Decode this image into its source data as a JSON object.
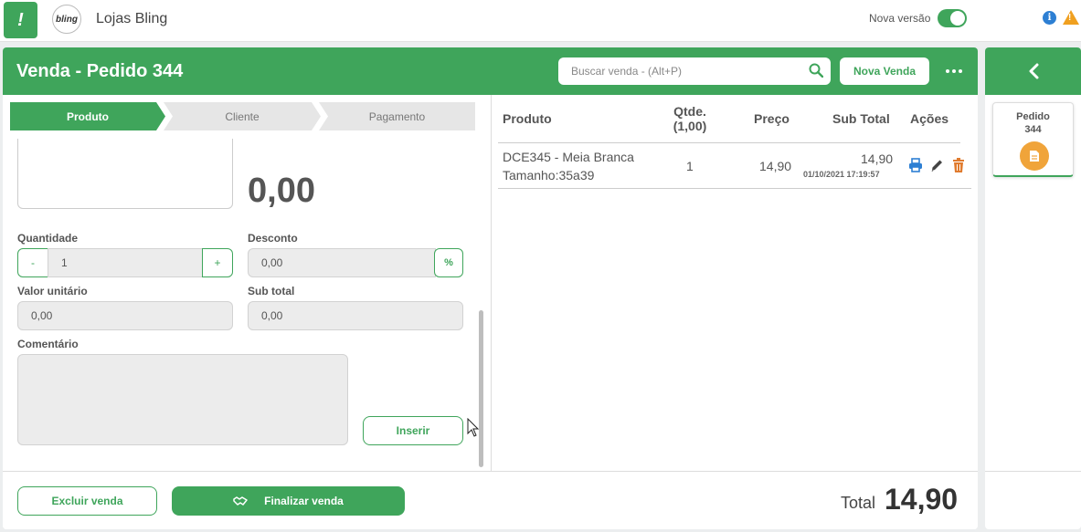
{
  "topbar": {
    "store_name": "Lojas Bling",
    "avatar_text": "bling",
    "new_version_label": "Nova versão",
    "new_version_enabled": true
  },
  "header": {
    "title": "Venda - Pedido 344",
    "search_placeholder": "Buscar venda - (Alt+P)",
    "new_sale_label": "Nova Venda"
  },
  "steps": [
    {
      "label": "Produto",
      "active": true
    },
    {
      "label": "Cliente",
      "active": false
    },
    {
      "label": "Pagamento",
      "active": false
    }
  ],
  "form": {
    "price_display": "0,00",
    "quantity_label": "Quantidade",
    "quantity_value": "1",
    "decrement_label": "-",
    "increment_label": "+",
    "discount_label": "Desconto",
    "discount_value": "0,00",
    "percent_label": "%",
    "unit_value_label": "Valor unitário",
    "unit_value": "0,00",
    "subtotal_label": "Sub total",
    "subtotal_value": "0,00",
    "comment_label": "Comentário",
    "insert_label": "Inserir"
  },
  "table": {
    "headers": {
      "product": "Produto",
      "qty_line1": "Qtde.",
      "qty_line2": "(1,00)",
      "price": "Preço",
      "subtotal": "Sub Total",
      "actions": "Ações"
    },
    "rows": [
      {
        "product_line1": "DCE345 - Meia Branca",
        "product_line2": "Tamanho:35a39",
        "qty": "1",
        "price": "14,90",
        "subtotal": "14,90",
        "timestamp": "01/10/2021 17:19:57"
      }
    ]
  },
  "footer": {
    "delete_label": "Excluir venda",
    "finalize_label": "Finalizar venda",
    "total_label": "Total",
    "total_value": "14,90"
  },
  "side": {
    "order_tab_line1": "Pedido",
    "order_tab_line2": "344"
  },
  "colors": {
    "brand_green": "#3fa55b",
    "print_blue": "#2d7fd3",
    "delete_orange": "#e07b2e",
    "badge_orange": "#f0a43a"
  },
  "icons": [
    "logo-icon",
    "info-icon",
    "warning-icon",
    "search-icon",
    "more-icon",
    "print-icon",
    "edit-icon",
    "trash-icon",
    "handshake-icon",
    "chevron-left-icon",
    "document-icon"
  ]
}
